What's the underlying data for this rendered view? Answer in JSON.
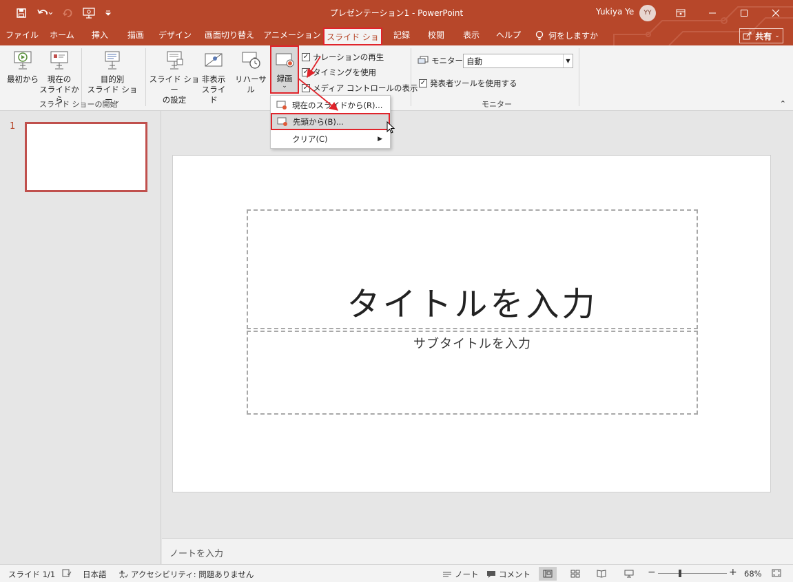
{
  "window": {
    "title": "プレゼンテーション1  -  PowerPoint",
    "user_name": "Yukiya Ye",
    "user_initials": "YY"
  },
  "tabs": [
    {
      "label": "ファイル"
    },
    {
      "label": "ホーム"
    },
    {
      "label": "挿入"
    },
    {
      "label": "描画"
    },
    {
      "label": "デザイン"
    },
    {
      "label": "画面切り替え"
    },
    {
      "label": "アニメーション"
    },
    {
      "label": "スライド ショー",
      "active": true
    },
    {
      "label": "記録"
    },
    {
      "label": "校閲"
    },
    {
      "label": "表示"
    },
    {
      "label": "ヘルプ"
    }
  ],
  "tell_me": "何をしますか",
  "share_label": "共有",
  "ribbon": {
    "start_group": {
      "from_beginning": [
        "最初から"
      ],
      "from_current": [
        "現在の",
        "スライドから"
      ],
      "custom": [
        "目的別",
        "スライド ショー"
      ],
      "label": "スライド ショーの開始"
    },
    "setup_group": {
      "setup": [
        "スライド ショー",
        "の設定"
      ],
      "hide": [
        "非表示",
        "スライド"
      ],
      "rehearse": "リハーサル",
      "record": "録画",
      "narration": "ナレーションの再生",
      "timing": "タイミングを使用",
      "media_controls": "メディア コントロールの表示"
    },
    "monitor_group": {
      "monitor_label": "モニター:",
      "monitor_value": "自動",
      "presenter_view": "発表者ツールを使用する",
      "label": "モニター"
    }
  },
  "record_menu": {
    "items": [
      {
        "label": "現在のスライドから(R)..."
      },
      {
        "label": "先頭から(B)...",
        "highlighted": true
      },
      {
        "label": "クリア(C)"
      }
    ]
  },
  "thumbnails": {
    "slide_number": "1"
  },
  "slide": {
    "title_placeholder": "タイトルを入力",
    "subtitle_placeholder": "サブタイトルを入力"
  },
  "notes_placeholder": "ノートを入力",
  "status": {
    "slide_indicator": "スライド 1/1",
    "language": "日本語",
    "accessibility": "アクセシビリティ: 問題ありません",
    "notes": "ノート",
    "comments": "コメント",
    "zoom": "68%",
    "zoom_level": 0.68
  },
  "colors": {
    "accent": "#b7472a",
    "highlight_border": "#e0242b"
  }
}
